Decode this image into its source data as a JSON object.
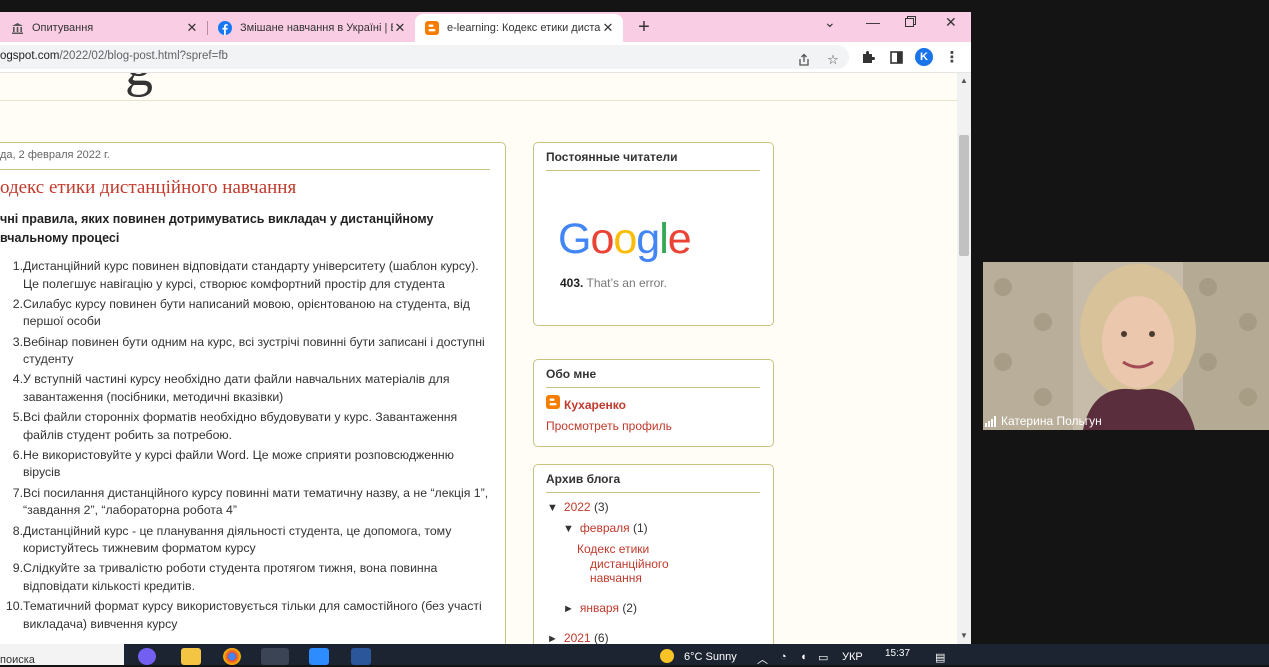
{
  "browser": {
    "tabs": [
      {
        "title": "Опитування",
        "icon": "university-icon",
        "active": false
      },
      {
        "title": "Змішане навчання в Україні | Bl",
        "icon": "facebook-icon",
        "active": false
      },
      {
        "title": "e-learning: Кодекс етики дистан",
        "icon": "blogger-icon",
        "active": true
      }
    ],
    "url_host": "ogspot.com",
    "url_path": "/2022/02/blog-post.html?spref=fb",
    "profile_initial": "K"
  },
  "post": {
    "date": "да, 2 февраля 2022 г.",
    "title": "одекс етики дистанційного навчання",
    "intro": "чні правила, яких повинен дотримуватись викладач у дистанційному вчальному процесі",
    "rules": [
      "Дистанційний курс повинен відповідати стандарту університету (шаблон курсу). Це полегшує навігацію у курсі, створює комфортний простір для студента",
      "Силабус курсу повинен бути написаний мовою, орієнтованою на студента, від першої особи",
      "Вебінар повинен бути одним на курс, всі зустрічі повинні бути записані і доступні студенту",
      "У вступній частині курсу необхідно дати файли навчальних матеріалів для завантаження (посібники, методичні вказівки)",
      "Всі файли сторонніх форматів необхідно вбудовувати у курс. Завантаження файлів студент робить за потребою.",
      "Не використовуйте у курсі файли Word. Це може сприяти розповсюдженню вірусів",
      "Всі посилання дистанційного курсу повинні мати тематичну назву, а не “лекція 1”, “завдання 2”, “лабораторна  робота 4”",
      "Дистанційний курс - це планування діяльності студента, це допомога, тому користуйтесь тижневим форматом курсу",
      "Слідкуйте за тривалістю роботи студента протягом тижня, вона повинна відповідати кількості кредитів.",
      "Тематичний формат курсу використовується тільки для самостійного (без участі викладача) вивчення курсу"
    ]
  },
  "sidebar": {
    "followers": {
      "title": "Постоянные читатели",
      "google_logo": "Google",
      "error_code": "403.",
      "error_text": "That’s an error."
    },
    "about": {
      "title": "Обо мне",
      "name": "Кухаренко",
      "profile_link": "Просмотреть профиль"
    },
    "archive": {
      "title": "Архив блога",
      "year_2022": "2022",
      "year_2022_count": "(3)",
      "feb": "февраля",
      "feb_count": "(1)",
      "post_line1": "Кодекс етики",
      "post_line2": "дистанційного",
      "post_line3": "навчання",
      "jan": "января",
      "jan_count": "(2)",
      "year_2021": "2021",
      "year_2021_count": "(6)"
    }
  },
  "video": {
    "participant_name": "Катерина Польгун"
  },
  "taskbar": {
    "search_text": "поиска",
    "weather": "6°C  Sunny",
    "language": "УКР",
    "time": "15:37"
  },
  "colors": {
    "tabstrip": "#f9cde4",
    "link": "#c0392b",
    "widget_border": "#c9c27d",
    "page_bg": "#fffdf6"
  }
}
